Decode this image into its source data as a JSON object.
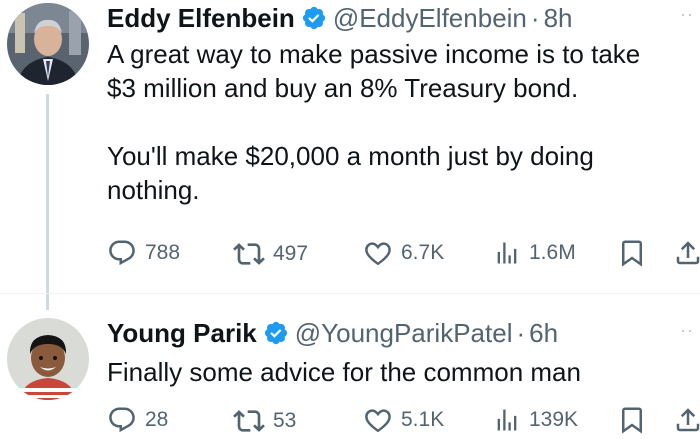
{
  "tweets": [
    {
      "author": "Eddy Elfenbein",
      "handle": "@EddyElfenbein",
      "separator": "·",
      "time": "8h",
      "text_lines": [
        "A great way to make passive income is to take",
        "$3 million and buy an 8% Treasury bond.",
        "",
        "You'll make $20,000 a month just by doing",
        "nothing."
      ],
      "replies": "788",
      "retweets": "497",
      "likes": "6.7K",
      "views": "1.6M"
    },
    {
      "author": "Young Parik",
      "handle": "@YoungParikPatel",
      "separator": "·",
      "time": "6h",
      "text_lines": [
        "Finally some advice for the common man"
      ],
      "replies": "28",
      "retweets": "53",
      "likes": "5.1K",
      "views": "139K"
    }
  ],
  "colors": {
    "verified_blue": "#1d9bf0",
    "secondary_text": "#536471",
    "primary_text": "#0f1419",
    "thread_line": "#cfd9de"
  },
  "icons": [
    "reply-icon",
    "retweet-icon",
    "like-icon",
    "views-icon",
    "bookmark-icon",
    "share-icon",
    "verified-badge-icon",
    "more-options-icon"
  ]
}
